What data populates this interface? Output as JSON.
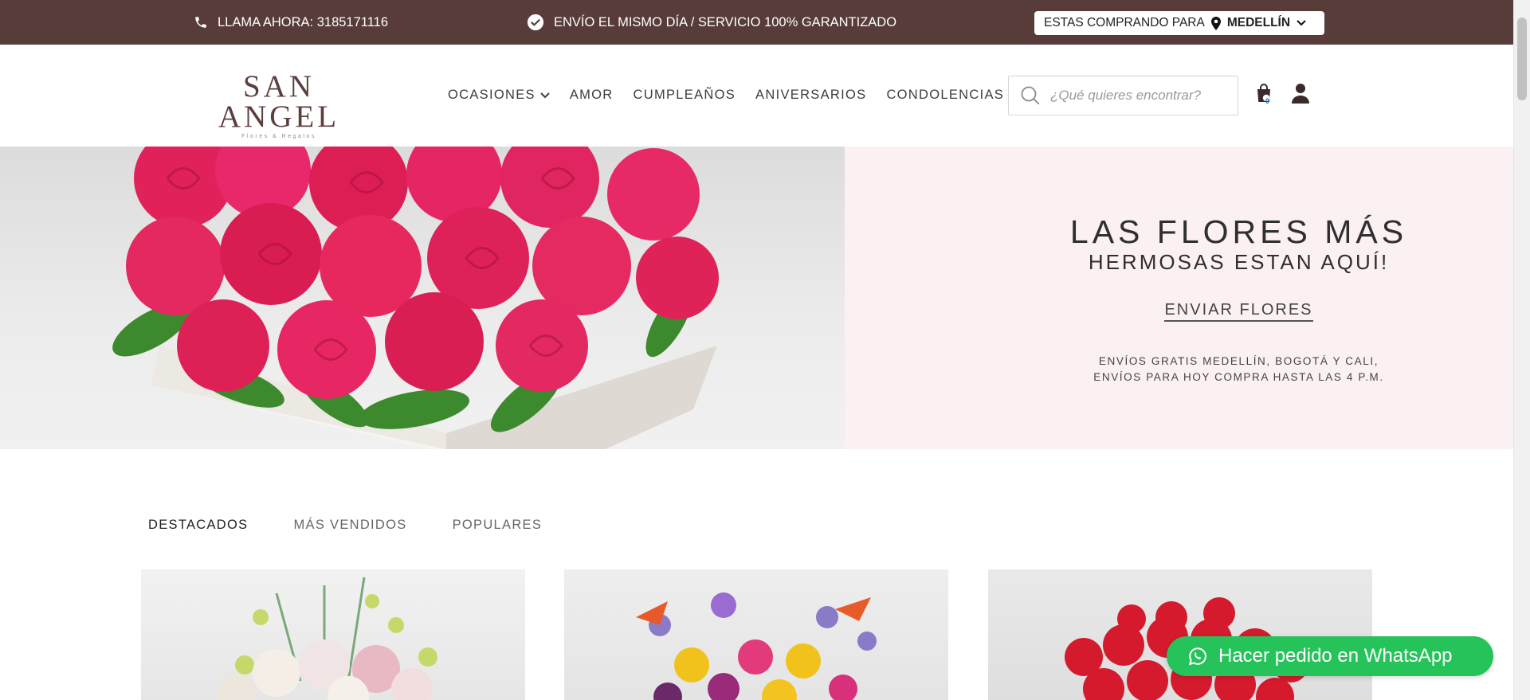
{
  "topbar": {
    "phone_text": "LLAMA AHORA: 3185171116",
    "shipping_text": "ENVÍO EL MISMO DÍA / SERVICIO 100% GARANTIZADO",
    "buying_for_label": "ESTAS COMPRANDO PARA",
    "city": "MEDELLÍN"
  },
  "header": {
    "logo_name": "SAN ANGEL",
    "logo_tagline": "Flores & Regalos",
    "nav": [
      {
        "label": "OCASIONES"
      },
      {
        "label": "AMOR"
      },
      {
        "label": "CUMPLEAÑOS"
      },
      {
        "label": "ANIVERSARIOS"
      },
      {
        "label": "CONDOLENCIAS"
      }
    ],
    "search_placeholder": "¿Qué quieres encontrar?",
    "cart_count": "0"
  },
  "hero": {
    "title": "LAS FLORES MÁS",
    "subtitle": "HERMOSAS ESTAN AQUÍ!",
    "cta": "ENVIAR FLORES",
    "note_line1": "ENVÍOS GRATIS MEDELLÍN, BOGOTÁ Y CALI,",
    "note_line2": "ENVÍOS PARA HOY COMPRA HASTA LAS 4 P.M."
  },
  "tabs": [
    {
      "label": "DESTACADOS"
    },
    {
      "label": "MÁS VENDIDOS"
    },
    {
      "label": "POPULARES"
    }
  ],
  "whatsapp": {
    "label": "Hacer pedido en WhatsApp"
  },
  "colors": {
    "topbar_bg": "#573c3a",
    "hero_panel_bg": "#fbf0f2",
    "whatsapp_green": "#25c35a",
    "rose": "#e6245c"
  }
}
